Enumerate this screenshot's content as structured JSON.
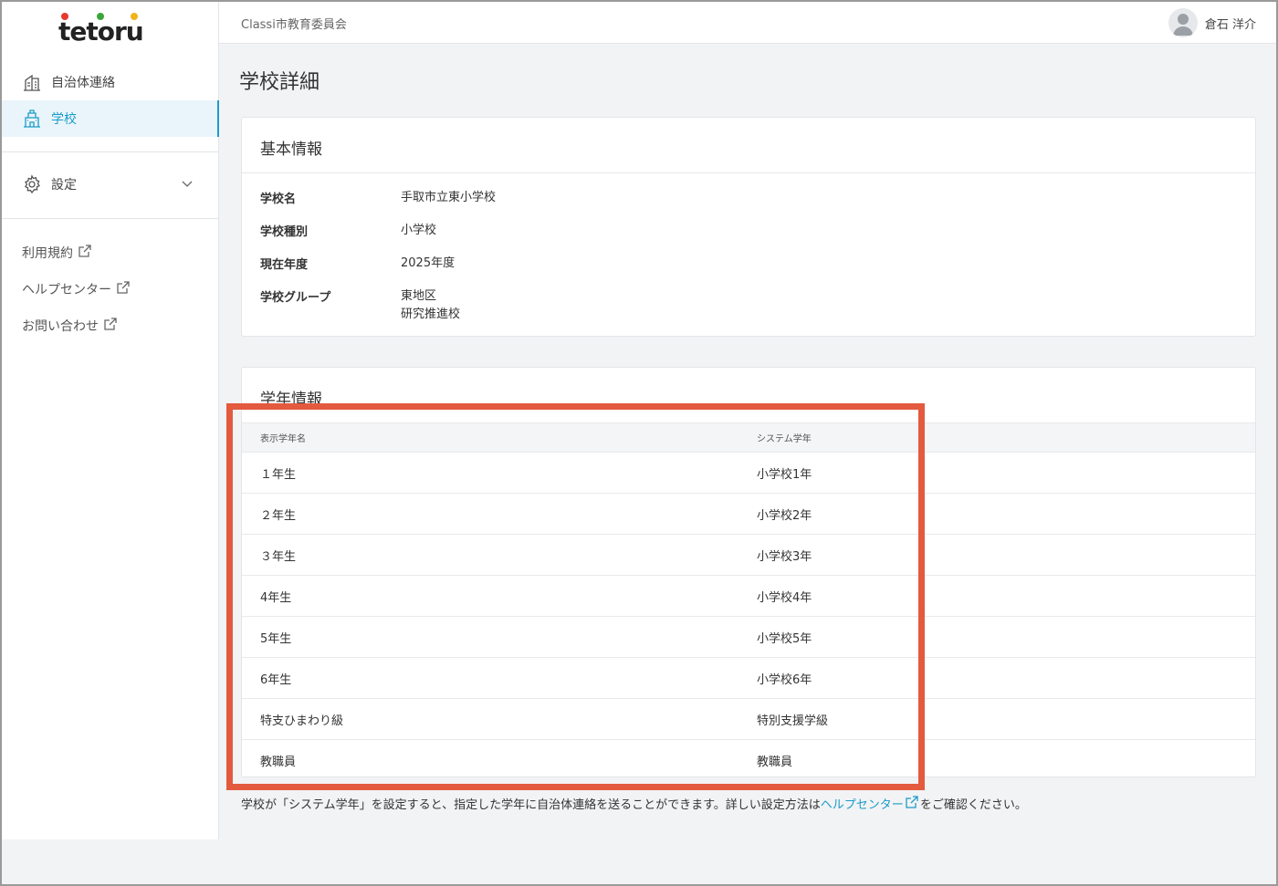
{
  "logo": {
    "text": "tetoru",
    "dot_colors": [
      "#e6392e",
      "#3aa63a",
      "#f2b21b"
    ]
  },
  "header": {
    "org_name": "Classi市教育委員会",
    "user_name": "倉石 洋介"
  },
  "sidebar": {
    "items": [
      {
        "label": "自治体連絡",
        "icon": "building-icon"
      },
      {
        "label": "学校",
        "icon": "school-icon",
        "active": true
      },
      {
        "label": "設定",
        "icon": "gear-icon"
      }
    ],
    "links": [
      {
        "label": "利用規約"
      },
      {
        "label": "ヘルプセンター"
      },
      {
        "label": "お問い合わせ"
      }
    ]
  },
  "page": {
    "title": "学校詳細"
  },
  "basic_info": {
    "title": "基本情報",
    "rows": [
      {
        "label": "学校名",
        "value": "手取市立東小学校"
      },
      {
        "label": "学校種別",
        "value": "小学校"
      },
      {
        "label": "現在年度",
        "value": "2025年度"
      },
      {
        "label": "学校グループ",
        "value": "東地区",
        "value2": "研究推進校"
      }
    ]
  },
  "grade_info": {
    "title": "学年情報",
    "columns": [
      "表示学年名",
      "システム学年"
    ],
    "rows": [
      [
        "１年生",
        "小学校1年"
      ],
      [
        "２年生",
        "小学校2年"
      ],
      [
        "３年生",
        "小学校3年"
      ],
      [
        "4年生",
        "小学校4年"
      ],
      [
        "5年生",
        "小学校5年"
      ],
      [
        "6年生",
        "小学校6年"
      ],
      [
        "特支ひまわり級",
        "特別支援学級"
      ],
      [
        "教職員",
        "教職員"
      ]
    ]
  },
  "footnote": {
    "before": "学校が「システム学年」を設定すると、指定した学年に自治体連絡を送ることができます。詳しい設定方法は",
    "link": "ヘルプセンター",
    "after": "をご確認ください。"
  },
  "colors": {
    "accent": "#1a9cc8",
    "highlight": "#e35a3f"
  }
}
